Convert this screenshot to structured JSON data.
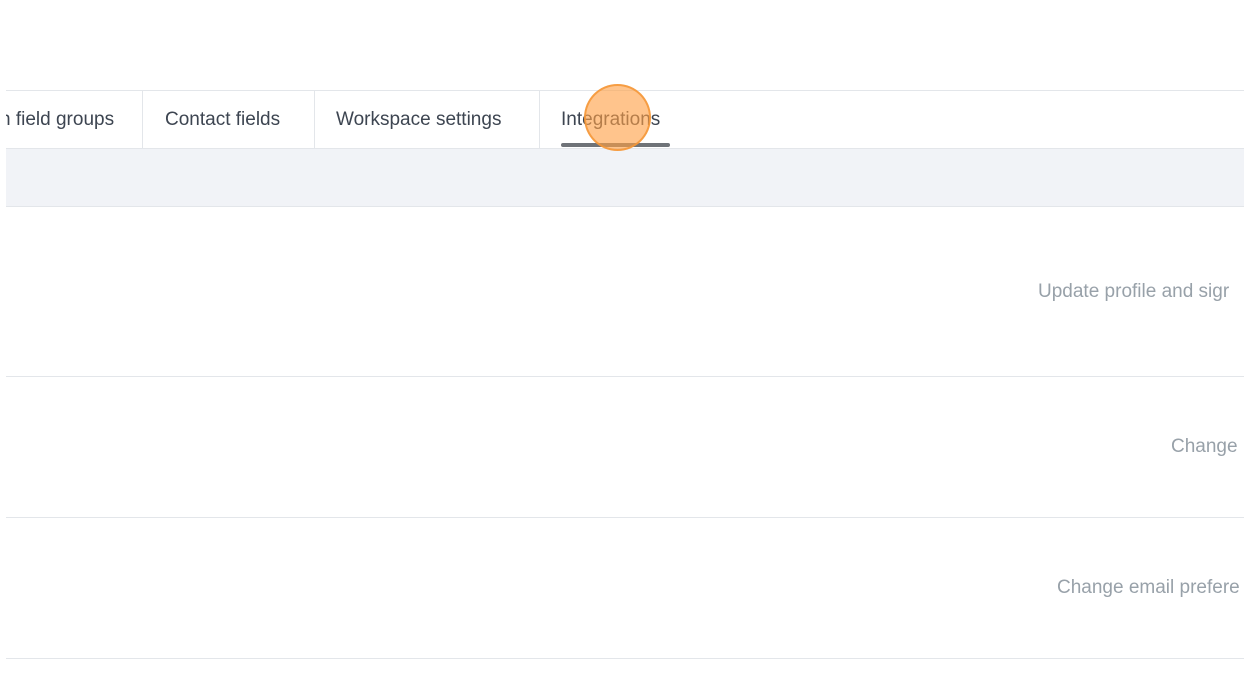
{
  "tabs": [
    {
      "label": "n field groups"
    },
    {
      "label": "Contact fields"
    },
    {
      "label": "Workspace settings"
    },
    {
      "label": "Integrations",
      "active": true
    }
  ],
  "settings_rows": [
    {
      "link": "Update profile and sigr"
    },
    {
      "link": "Change"
    },
    {
      "link": "Change email prefere"
    }
  ],
  "colors": {
    "tab_text": "#3d4551",
    "row_link_text": "#98a1a9",
    "active_underline": "#6f7378",
    "band_background": "#f1f3f7",
    "click_marker": "#ffa046"
  }
}
